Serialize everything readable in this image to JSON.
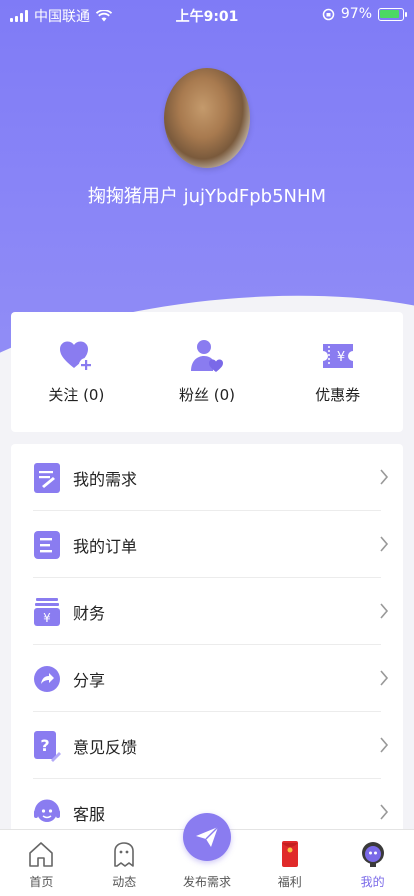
{
  "status_bar": {
    "carrier": "中国联通",
    "time": "上午9:01",
    "battery": "97%"
  },
  "profile": {
    "username": "掬掬猪用户 jujYbdFpb5NHM"
  },
  "stats": [
    {
      "label": "关注 (0)",
      "icon": "heart-plus-icon"
    },
    {
      "label": "粉丝 (0)",
      "icon": "person-heart-icon"
    },
    {
      "label": "优惠券",
      "icon": "coupon-icon"
    }
  ],
  "menu": [
    {
      "label": "我的需求",
      "icon": "requirements-icon"
    },
    {
      "label": "我的订单",
      "icon": "orders-icon"
    },
    {
      "label": "财务",
      "icon": "finance-icon"
    },
    {
      "label": "分享",
      "icon": "share-icon"
    },
    {
      "label": "意见反馈",
      "icon": "feedback-icon"
    },
    {
      "label": "客服",
      "icon": "customer-service-icon"
    }
  ],
  "tabbar": {
    "tabs": [
      {
        "label": "首页",
        "icon": "home-icon"
      },
      {
        "label": "动态",
        "icon": "moments-icon"
      },
      {
        "label": "发布需求",
        "icon": "send-icon"
      },
      {
        "label": "福利",
        "icon": "red-envelope-icon"
      },
      {
        "label": "我的",
        "icon": "profile-icon"
      }
    ],
    "active_index": 4
  },
  "colors": {
    "accent": "#8a7cf0",
    "header_gradient_top": "#7f7bf6",
    "background": "#f3f3f7"
  }
}
